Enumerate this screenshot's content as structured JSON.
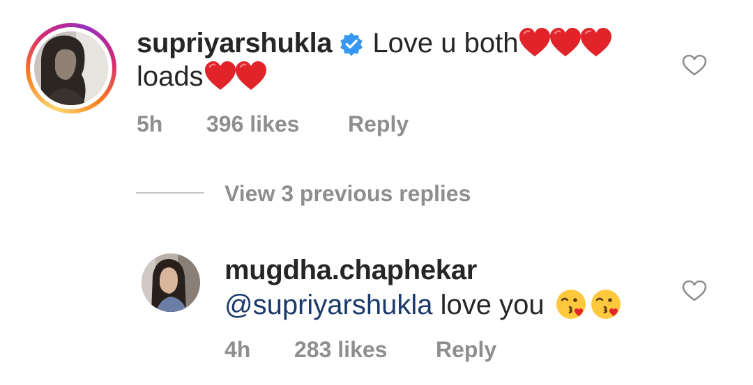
{
  "main_comment": {
    "username": "supriyarshukla",
    "text_line1": "Love u both",
    "text_line2": "loads",
    "time": "5h",
    "likes": "396 likes",
    "reply_label": "Reply",
    "verified": true,
    "icons": [
      "verified-badge-icon",
      "heart-emoji-icon",
      "like-heart-icon"
    ],
    "colors": {
      "verified": "#3897f0",
      "heart_emoji": "#e0242a"
    }
  },
  "thread": {
    "view_replies_label": "View 3 previous replies"
  },
  "reply": {
    "username": "mugdha.chaphekar",
    "mention": "@supriyarshukla",
    "text": "love you",
    "time": "4h",
    "likes": "283 likes",
    "reply_label": "Reply",
    "icons": [
      "kissing-face-emoji-icon",
      "like-heart-icon"
    ],
    "colors": {
      "mention": "#1a3a6b"
    }
  }
}
